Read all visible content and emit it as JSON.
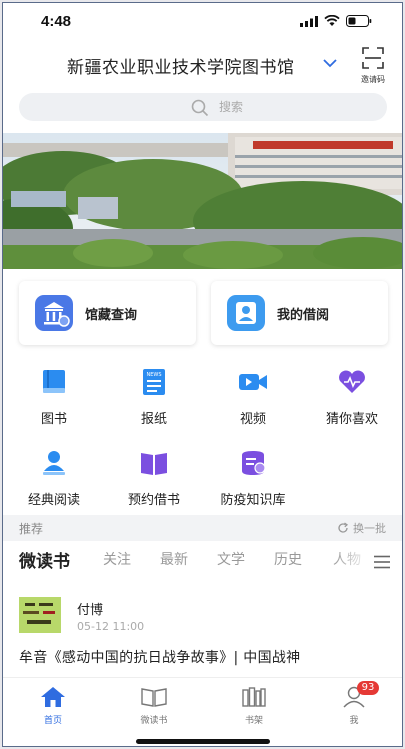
{
  "status_bar": {
    "time": "4:48"
  },
  "header": {
    "library_name": "新疆农业职业技术学院图书馆",
    "scan_label": "邀请码"
  },
  "search": {
    "placeholder": "搜索"
  },
  "quick_cards": [
    {
      "label": "馆藏查询",
      "icon": "library-building-icon",
      "color": "#4a78e6"
    },
    {
      "label": "我的借阅",
      "icon": "borrow-portrait-icon",
      "color": "#3d9bef"
    }
  ],
  "grid": [
    {
      "label": "图书",
      "icon": "book-icon"
    },
    {
      "label": "报纸",
      "icon": "newspaper-icon"
    },
    {
      "label": "视频",
      "icon": "video-icon"
    },
    {
      "label": "猜你喜欢",
      "icon": "heart-icon"
    },
    {
      "label": "经典阅读",
      "icon": "reader-person-icon"
    },
    {
      "label": "预约借书",
      "icon": "open-book-icon"
    },
    {
      "label": "防疫知识库",
      "icon": "knowledge-base-icon"
    }
  ],
  "recommend": {
    "title": "推荐",
    "refresh": "换一批"
  },
  "tabs": [
    "微读书",
    "关注",
    "最新",
    "文学",
    "历史",
    "人物"
  ],
  "post": {
    "author": "付博",
    "time": "05-12 11:00",
    "title": "牟音《感动中国的抗日战争故事》| 中国战神"
  },
  "nav": [
    {
      "label": "首页",
      "icon": "home-icon"
    },
    {
      "label": "微读书",
      "icon": "open-book-outline-icon"
    },
    {
      "label": "书架",
      "icon": "bookshelf-icon"
    },
    {
      "label": "我",
      "icon": "profile-icon",
      "badge": "93"
    }
  ],
  "colors": {
    "accent": "#2f6ce0",
    "news_blue": "#2b8cf0",
    "purple": "#7b4fe0"
  }
}
